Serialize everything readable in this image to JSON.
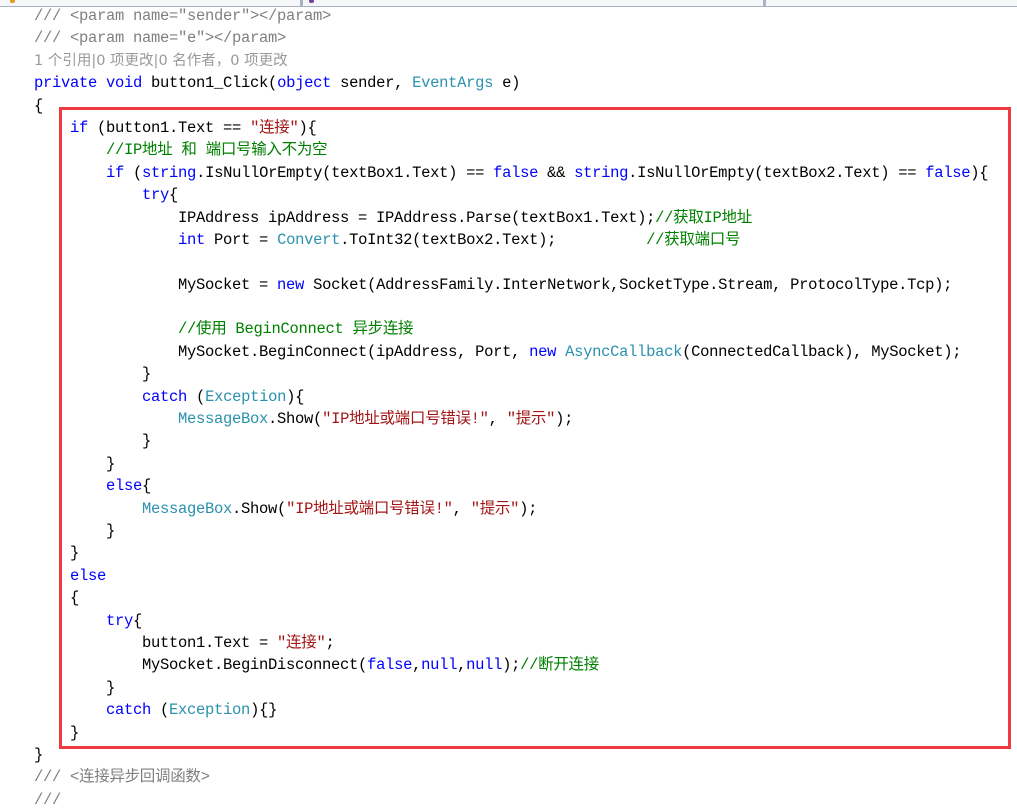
{
  "editor": {
    "tabs": [
      {
        "name": "file-tab-1"
      },
      {
        "name": "file-tab-2"
      }
    ],
    "codelens": "1 个引用|0 项更改|0 名作者，0 项更改",
    "highlight_color": "#ef3a3f",
    "lines": [
      [
        {
          "c": "doc",
          "t": "/// <param name=\"sender\"></param>"
        }
      ],
      [
        {
          "c": "doc",
          "t": "/// <param name=\"e\"></param>"
        }
      ],
      [
        {
          "c": "lens",
          "t": "1 个引用|0 项更改|0 名作者，0 项更改"
        }
      ],
      [
        {
          "c": "kw",
          "t": "private void "
        },
        {
          "c": "",
          "t": "button1_Click("
        },
        {
          "c": "kw",
          "t": "object"
        },
        {
          "c": "",
          "t": " sender, "
        },
        {
          "c": "ty",
          "t": "EventArgs"
        },
        {
          "c": "",
          "t": " e)"
        }
      ],
      [
        {
          "c": "",
          "t": "{"
        }
      ],
      [
        {
          "c": "",
          "t": "    "
        },
        {
          "c": "kw",
          "t": "if"
        },
        {
          "c": "",
          "t": " (button1.Text == "
        },
        {
          "c": "str",
          "t": "\"连接\""
        },
        {
          "c": "",
          "t": "){"
        }
      ],
      [
        {
          "c": "",
          "t": "        "
        },
        {
          "c": "cm",
          "t": "//IP地址 和 端口号输入不为空"
        }
      ],
      [
        {
          "c": "",
          "t": "        "
        },
        {
          "c": "kw",
          "t": "if"
        },
        {
          "c": "",
          "t": " ("
        },
        {
          "c": "kw",
          "t": "string"
        },
        {
          "c": "",
          "t": ".IsNullOrEmpty(textBox1.Text) == "
        },
        {
          "c": "kw",
          "t": "false"
        },
        {
          "c": "",
          "t": " && "
        },
        {
          "c": "kw",
          "t": "string"
        },
        {
          "c": "",
          "t": ".IsNullOrEmpty(textBox2.Text) == "
        },
        {
          "c": "kw",
          "t": "false"
        },
        {
          "c": "",
          "t": "){"
        }
      ],
      [
        {
          "c": "",
          "t": "            "
        },
        {
          "c": "kw",
          "t": "try"
        },
        {
          "c": "",
          "t": "{"
        }
      ],
      [
        {
          "c": "",
          "t": "                IPAddress ipAddress = IPAddress.Parse(textBox1.Text);"
        },
        {
          "c": "cm",
          "t": "//获取IP地址"
        }
      ],
      [
        {
          "c": "",
          "t": "                "
        },
        {
          "c": "kw",
          "t": "int"
        },
        {
          "c": "",
          "t": " Port = "
        },
        {
          "c": "ty",
          "t": "Convert"
        },
        {
          "c": "",
          "t": ".ToInt32(textBox2.Text);          "
        },
        {
          "c": "cm",
          "t": "//获取端口号"
        }
      ],
      [
        {
          "c": "",
          "t": ""
        }
      ],
      [
        {
          "c": "",
          "t": "                MySocket = "
        },
        {
          "c": "kw",
          "t": "new"
        },
        {
          "c": "",
          "t": " Socket(AddressFamily.InterNetwork,SocketType.Stream, ProtocolType.Tcp);"
        }
      ],
      [
        {
          "c": "",
          "t": ""
        }
      ],
      [
        {
          "c": "",
          "t": "                "
        },
        {
          "c": "cm",
          "t": "//使用 BeginConnect 异步连接"
        }
      ],
      [
        {
          "c": "",
          "t": "                MySocket.BeginConnect(ipAddress, Port, "
        },
        {
          "c": "kw",
          "t": "new"
        },
        {
          "c": "",
          "t": " "
        },
        {
          "c": "ty",
          "t": "AsyncCallback"
        },
        {
          "c": "",
          "t": "(ConnectedCallback), MySocket);"
        }
      ],
      [
        {
          "c": "",
          "t": "            }"
        }
      ],
      [
        {
          "c": "",
          "t": "            "
        },
        {
          "c": "kw",
          "t": "catch"
        },
        {
          "c": "",
          "t": " ("
        },
        {
          "c": "ty",
          "t": "Exception"
        },
        {
          "c": "",
          "t": "){"
        }
      ],
      [
        {
          "c": "",
          "t": "                "
        },
        {
          "c": "ty",
          "t": "MessageBox"
        },
        {
          "c": "",
          "t": ".Show("
        },
        {
          "c": "str",
          "t": "\"IP地址或端口号错误!\""
        },
        {
          "c": "",
          "t": ", "
        },
        {
          "c": "str",
          "t": "\"提示\""
        },
        {
          "c": "",
          "t": ");"
        }
      ],
      [
        {
          "c": "",
          "t": "            }"
        }
      ],
      [
        {
          "c": "",
          "t": "        }"
        }
      ],
      [
        {
          "c": "",
          "t": "        "
        },
        {
          "c": "kw",
          "t": "else"
        },
        {
          "c": "",
          "t": "{"
        }
      ],
      [
        {
          "c": "",
          "t": "            "
        },
        {
          "c": "ty",
          "t": "MessageBox"
        },
        {
          "c": "",
          "t": ".Show("
        },
        {
          "c": "str",
          "t": "\"IP地址或端口号错误!\""
        },
        {
          "c": "",
          "t": ", "
        },
        {
          "c": "str",
          "t": "\"提示\""
        },
        {
          "c": "",
          "t": ");"
        }
      ],
      [
        {
          "c": "",
          "t": "        }"
        }
      ],
      [
        {
          "c": "",
          "t": "    }"
        }
      ],
      [
        {
          "c": "",
          "t": "    "
        },
        {
          "c": "kw",
          "t": "else"
        }
      ],
      [
        {
          "c": "",
          "t": "    {"
        }
      ],
      [
        {
          "c": "",
          "t": "        "
        },
        {
          "c": "kw",
          "t": "try"
        },
        {
          "c": "",
          "t": "{"
        }
      ],
      [
        {
          "c": "",
          "t": "            button1.Text = "
        },
        {
          "c": "str",
          "t": "\"连接\""
        },
        {
          "c": "",
          "t": ";"
        }
      ],
      [
        {
          "c": "",
          "t": "            MySocket.BeginDisconnect("
        },
        {
          "c": "kw",
          "t": "false"
        },
        {
          "c": "",
          "t": ","
        },
        {
          "c": "kw",
          "t": "null"
        },
        {
          "c": "",
          "t": ","
        },
        {
          "c": "kw",
          "t": "null"
        },
        {
          "c": "",
          "t": ");"
        },
        {
          "c": "cm",
          "t": "//断开连接"
        }
      ],
      [
        {
          "c": "",
          "t": "        }"
        }
      ],
      [
        {
          "c": "",
          "t": "        "
        },
        {
          "c": "kw",
          "t": "catch"
        },
        {
          "c": "",
          "t": " ("
        },
        {
          "c": "ty",
          "t": "Exception"
        },
        {
          "c": "",
          "t": "){}"
        }
      ],
      [
        {
          "c": "",
          "t": "    }"
        }
      ],
      [
        {
          "c": "",
          "t": "}"
        }
      ],
      [
        {
          "c": "doc",
          "t": "/// <连接异步回调函数>"
        }
      ],
      [
        {
          "c": "doc",
          "t": "///"
        }
      ]
    ]
  }
}
